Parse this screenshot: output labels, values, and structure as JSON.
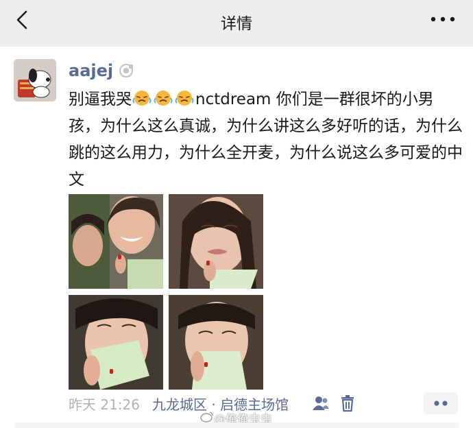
{
  "nav": {
    "title": "详情"
  },
  "post": {
    "username": "aajej",
    "text_before_emoji": "别逼我哭",
    "emojis": [
      "crying-face",
      "crying-face",
      "crying-face"
    ],
    "text_after_emoji": "nctdream 你们是一群很坏的小男孩，为什么这么真诚，为什么讲这么多好听的话，为什么跳的这么用力，为什么全开麦，为什么说这么多可爱的中文",
    "photos": [
      {
        "subject": "two-girls-laughing-selfie"
      },
      {
        "subject": "girl-crying-holding-tissue"
      },
      {
        "subject": "girl-tissue-over-nose"
      },
      {
        "subject": "girl-tissue-over-mouth"
      }
    ],
    "time": "昨天 21:26",
    "location": "九龙城区 · 启德主场馆"
  },
  "watermark": {
    "text": "@俺俺虫虫"
  },
  "colors": {
    "link": "#576b95",
    "nav_bg": "#ededed",
    "meta_gray": "#b2b2b2"
  }
}
